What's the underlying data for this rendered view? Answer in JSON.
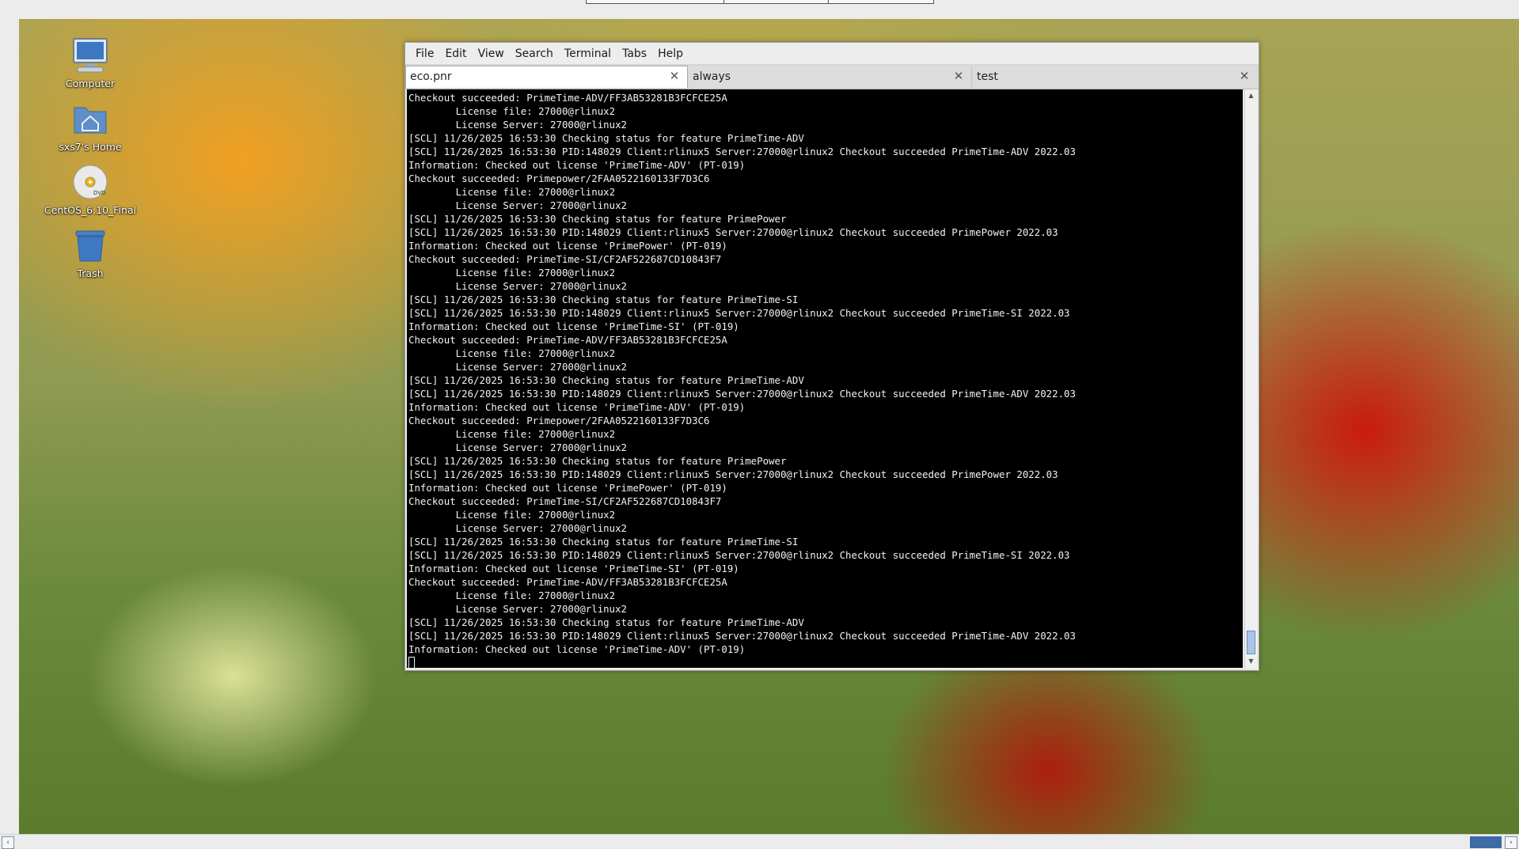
{
  "desktop": {
    "icons": [
      {
        "label": "Computer",
        "icon": "computer-icon"
      },
      {
        "label": "sxs7's Home",
        "icon": "home-folder-icon"
      },
      {
        "label": "CentOS_6.10_Final",
        "icon": "dvd-icon"
      },
      {
        "label": "Trash",
        "icon": "trash-icon"
      }
    ]
  },
  "terminal": {
    "menu": [
      "File",
      "Edit",
      "View",
      "Search",
      "Terminal",
      "Tabs",
      "Help"
    ],
    "tabs": [
      {
        "label": "eco.pnr",
        "active": true
      },
      {
        "label": "always",
        "active": false
      },
      {
        "label": "test",
        "active": false
      }
    ],
    "close_glyph": "✕",
    "lines": [
      "Checkout succeeded: PrimeTime-ADV/FF3AB53281B3FCFCE25A",
      "        License file: 27000@rlinux2",
      "        License Server: 27000@rlinux2",
      "[SCL] 11/26/2025 16:53:30 Checking status for feature PrimeTime-ADV",
      "[SCL] 11/26/2025 16:53:30 PID:148029 Client:rlinux5 Server:27000@rlinux2 Checkout succeeded PrimeTime-ADV 2022.03",
      "Information: Checked out license 'PrimeTime-ADV' (PT-019)",
      "Checkout succeeded: Primepower/2FAA0522160133F7D3C6",
      "        License file: 27000@rlinux2",
      "        License Server: 27000@rlinux2",
      "[SCL] 11/26/2025 16:53:30 Checking status for feature PrimePower",
      "[SCL] 11/26/2025 16:53:30 PID:148029 Client:rlinux5 Server:27000@rlinux2 Checkout succeeded PrimePower 2022.03",
      "Information: Checked out license 'PrimePower' (PT-019)",
      "Checkout succeeded: PrimeTime-SI/CF2AF522687CD10843F7",
      "        License file: 27000@rlinux2",
      "        License Server: 27000@rlinux2",
      "[SCL] 11/26/2025 16:53:30 Checking status for feature PrimeTime-SI",
      "[SCL] 11/26/2025 16:53:30 PID:148029 Client:rlinux5 Server:27000@rlinux2 Checkout succeeded PrimeTime-SI 2022.03",
      "Information: Checked out license 'PrimeTime-SI' (PT-019)",
      "Checkout succeeded: PrimeTime-ADV/FF3AB53281B3FCFCE25A",
      "        License file: 27000@rlinux2",
      "        License Server: 27000@rlinux2",
      "[SCL] 11/26/2025 16:53:30 Checking status for feature PrimeTime-ADV",
      "[SCL] 11/26/2025 16:53:30 PID:148029 Client:rlinux5 Server:27000@rlinux2 Checkout succeeded PrimeTime-ADV 2022.03",
      "Information: Checked out license 'PrimeTime-ADV' (PT-019)",
      "Checkout succeeded: Primepower/2FAA0522160133F7D3C6",
      "        License file: 27000@rlinux2",
      "        License Server: 27000@rlinux2",
      "[SCL] 11/26/2025 16:53:30 Checking status for feature PrimePower",
      "[SCL] 11/26/2025 16:53:30 PID:148029 Client:rlinux5 Server:27000@rlinux2 Checkout succeeded PrimePower 2022.03",
      "Information: Checked out license 'PrimePower' (PT-019)",
      "Checkout succeeded: PrimeTime-SI/CF2AF522687CD10843F7",
      "        License file: 27000@rlinux2",
      "        License Server: 27000@rlinux2",
      "[SCL] 11/26/2025 16:53:30 Checking status for feature PrimeTime-SI",
      "[SCL] 11/26/2025 16:53:30 PID:148029 Client:rlinux5 Server:27000@rlinux2 Checkout succeeded PrimeTime-SI 2022.03",
      "Information: Checked out license 'PrimeTime-SI' (PT-019)",
      "Checkout succeeded: PrimeTime-ADV/FF3AB53281B3FCFCE25A",
      "        License file: 27000@rlinux2",
      "        License Server: 27000@rlinux2",
      "[SCL] 11/26/2025 16:53:30 Checking status for feature PrimeTime-ADV",
      "[SCL] 11/26/2025 16:53:30 PID:148029 Client:rlinux5 Server:27000@rlinux2 Checkout succeeded PrimeTime-ADV 2022.03",
      "Information: Checked out license 'PrimeTime-ADV' (PT-019)"
    ]
  },
  "colors": {
    "terminal_bg": "#000000",
    "terminal_fg": "#f2f2f2",
    "scroll_thumb": "#a9c4e8",
    "panel_accent": "#3e6aa6"
  }
}
